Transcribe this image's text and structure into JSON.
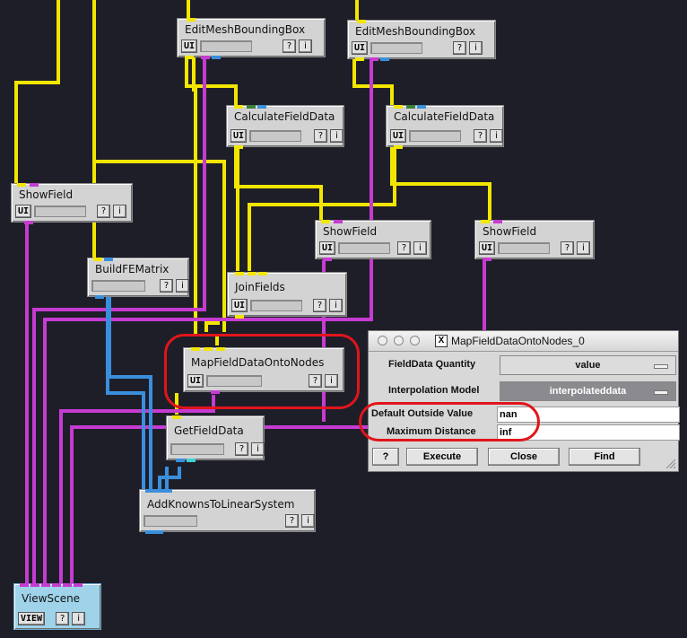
{
  "modules": {
    "ebb1": {
      "title": "EditMeshBoundingBox",
      "ui": "UI",
      "q": "?",
      "i": "i"
    },
    "ebb2": {
      "title": "EditMeshBoundingBox",
      "ui": "UI",
      "q": "?",
      "i": "i"
    },
    "cfd1": {
      "title": "CalculateFieldData",
      "ui": "UI",
      "q": "?",
      "i": "i"
    },
    "cfd2": {
      "title": "CalculateFieldData",
      "ui": "UI",
      "q": "?",
      "i": "i"
    },
    "sf1": {
      "title": "ShowField",
      "ui": "UI",
      "q": "?",
      "i": "i"
    },
    "sf2": {
      "title": "ShowField",
      "ui": "UI",
      "q": "?",
      "i": "i"
    },
    "sf3": {
      "title": "ShowField",
      "ui": "UI",
      "q": "?",
      "i": "i"
    },
    "bfe": {
      "title": "BuildFEMatrix",
      "q": "?",
      "i": "i"
    },
    "jf": {
      "title": "JoinFields",
      "ui": "UI",
      "q": "?",
      "i": "i"
    },
    "mfd": {
      "title": "MapFieldDataOntoNodes",
      "ui": "UI",
      "q": "?",
      "i": "i"
    },
    "gfd": {
      "title": "GetFieldData",
      "q": "?",
      "i": "i"
    },
    "akl": {
      "title": "AddKnownsToLinearSystem",
      "q": "?",
      "i": "i"
    },
    "vs": {
      "title": "ViewScene",
      "ui": "VIEW",
      "q": "?",
      "i": "i"
    }
  },
  "dialog": {
    "title": "MapFieldDataOntoNodes_0",
    "x_icon": "X",
    "rows": {
      "fieldDataQuantity": {
        "label": "FieldData Quantity",
        "value": "value"
      },
      "interpolationModel": {
        "label": "Interpolation Model",
        "value": "interpolateddata"
      },
      "defaultOutsideValue": {
        "label": "Default Outside Value",
        "value": "nan"
      },
      "maximumDistance": {
        "label": "Maximum Distance",
        "value": "inf"
      }
    },
    "buttons": {
      "help": "?",
      "execute": "Execute",
      "close": "Close",
      "find": "Find"
    }
  },
  "colors": {
    "background": "#1e1e29",
    "wire_yellow": "#f2e600",
    "wire_magenta": "#c63bd1",
    "wire_blue": "#3a8fdc",
    "highlight_ring": "#e0151b",
    "viewscene": "#9fd3ea",
    "interp_select": "#8a8a8f"
  }
}
